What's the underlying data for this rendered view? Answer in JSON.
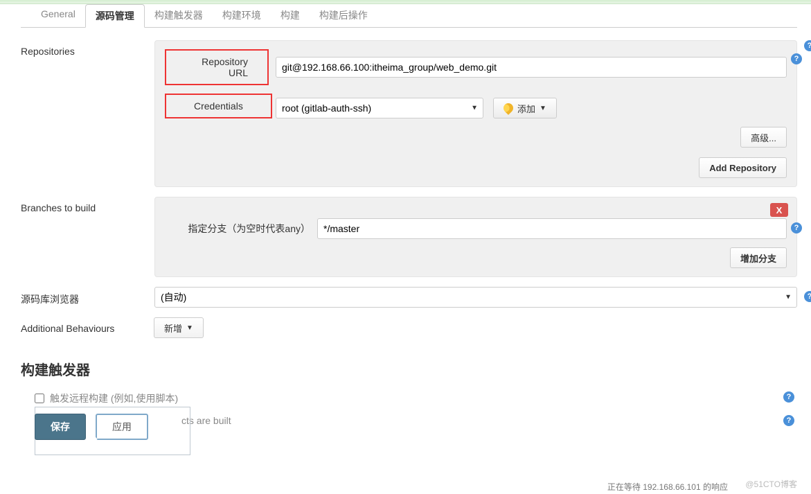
{
  "tabs": {
    "general": "General",
    "scm": "源码管理",
    "triggers": "构建触发器",
    "env": "构建环境",
    "build": "构建",
    "post": "构建后操作"
  },
  "scm": {
    "repositories_label": "Repositories",
    "repo_url_label": "Repository URL",
    "repo_url_value": "git@192.168.66.100:itheima_group/web_demo.git",
    "credentials_label": "Credentials",
    "credentials_value": "root (gitlab-auth-ssh)",
    "add_button": "添加",
    "advanced_button": "高级...",
    "add_repo_button": "Add Repository",
    "branches_label": "Branches to build",
    "branch_spec_label": "指定分支（为空时代表any）",
    "branch_spec_value": "*/master",
    "add_branch_button": "增加分支",
    "browser_label": "源码库浏览器",
    "browser_value": "(自动)",
    "add_behav_label": "Additional Behaviours",
    "add_behav_button": "新增"
  },
  "trigger": {
    "section_title": "构建触发器",
    "remote_label": "触发远程构建 (例如,使用脚本)",
    "after_projects_label": "cts are built"
  },
  "footer": {
    "save": "保存",
    "apply": "应用"
  },
  "misc": {
    "watermark": "@51CTO博客",
    "status": "正在等待 192.168.66.101 的响应"
  }
}
